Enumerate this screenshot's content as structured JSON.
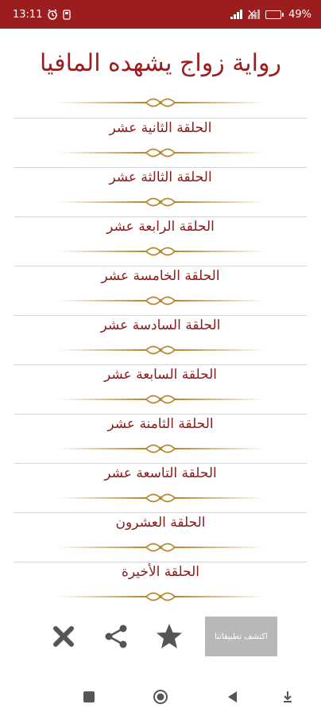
{
  "status_bar": {
    "time": "13:11",
    "battery_percent": "49",
    "battery_level": 0.49
  },
  "title": "رواية زواج يشهده المافيا",
  "episodes": [
    "الحلقة الثانية عشر",
    "الحلقة الثالثة عشر",
    "الحلقة الرابعة عشر",
    "الحلقة الخامسة عشر",
    "الحلقة السادسة عشر",
    "الحلقة السابعة عشر",
    "الحلقة الثامنة عشر",
    "الحلقة التاسعة عشر",
    "الحلقة العشرون",
    "الحلقة الأخيرة"
  ],
  "actions": {
    "discover_label": "اكتشف تطبيقاتنا",
    "icons": [
      "close-icon",
      "share-icon",
      "star-icon"
    ]
  },
  "nav": {
    "icons": [
      "recents-icon",
      "home-icon",
      "back-icon",
      "accessibility-icon"
    ]
  },
  "colors": {
    "status_bar": "#9b1d1d",
    "title": "#9b1d1d",
    "episode_text": "#8b1a1a",
    "divider_gold": "#b8862b",
    "action_icons": "#555555"
  }
}
